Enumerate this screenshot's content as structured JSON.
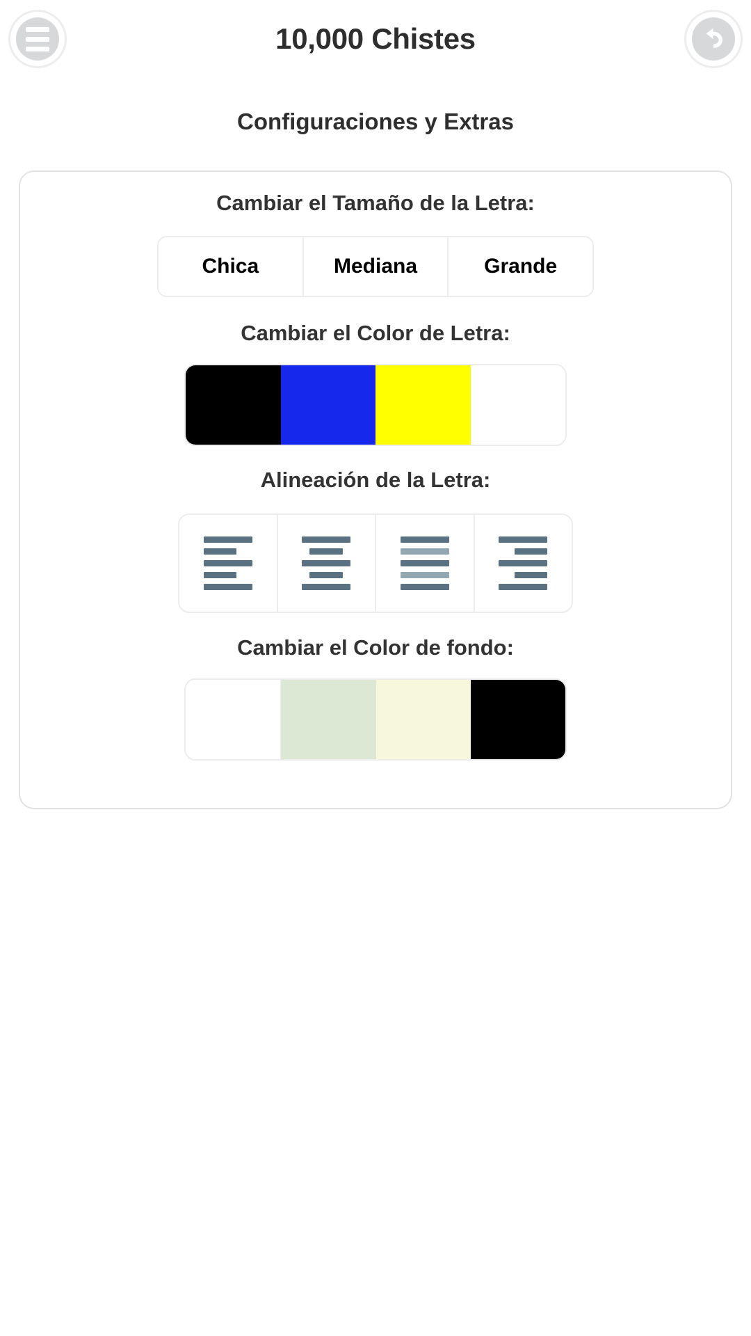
{
  "header": {
    "title": "10,000 Chistes",
    "menu_icon": "hamburger-menu-icon",
    "back_icon": "undo-back-arrow-icon"
  },
  "subtitle": "Configuraciones y Extras",
  "sections": {
    "font_size": {
      "title": "Cambiar el Tamaño de la Letra:",
      "options": [
        {
          "label": "Chica"
        },
        {
          "label": "Mediana"
        },
        {
          "label": "Grande"
        }
      ]
    },
    "font_color": {
      "title": "Cambiar el Color de Letra:",
      "options": [
        {
          "name": "black",
          "color": "#000000"
        },
        {
          "name": "blue",
          "color": "#1528EC"
        },
        {
          "name": "yellow",
          "color": "#FFFF00"
        },
        {
          "name": "white",
          "color": "#FFFFFF"
        }
      ]
    },
    "alignment": {
      "title": "Alineación de la Letra:",
      "options": [
        {
          "name": "align-left-icon"
        },
        {
          "name": "align-center-icon"
        },
        {
          "name": "align-justify-icon"
        },
        {
          "name": "align-right-icon"
        }
      ]
    },
    "background_color": {
      "title": "Cambiar el Color de fondo:",
      "options": [
        {
          "name": "white",
          "color": "#FFFFFF"
        },
        {
          "name": "pale-green",
          "color": "#DCE8D3"
        },
        {
          "name": "pale-yellow",
          "color": "#F7F8DB"
        },
        {
          "name": "black",
          "color": "#000000"
        }
      ]
    }
  },
  "theme": {
    "text_color": "#333333",
    "border_color": "#E2E2E2",
    "icon_gray": "#D6D8DA",
    "align_icon_dark": "#5A7181",
    "align_icon_light": "#93A7B2"
  }
}
